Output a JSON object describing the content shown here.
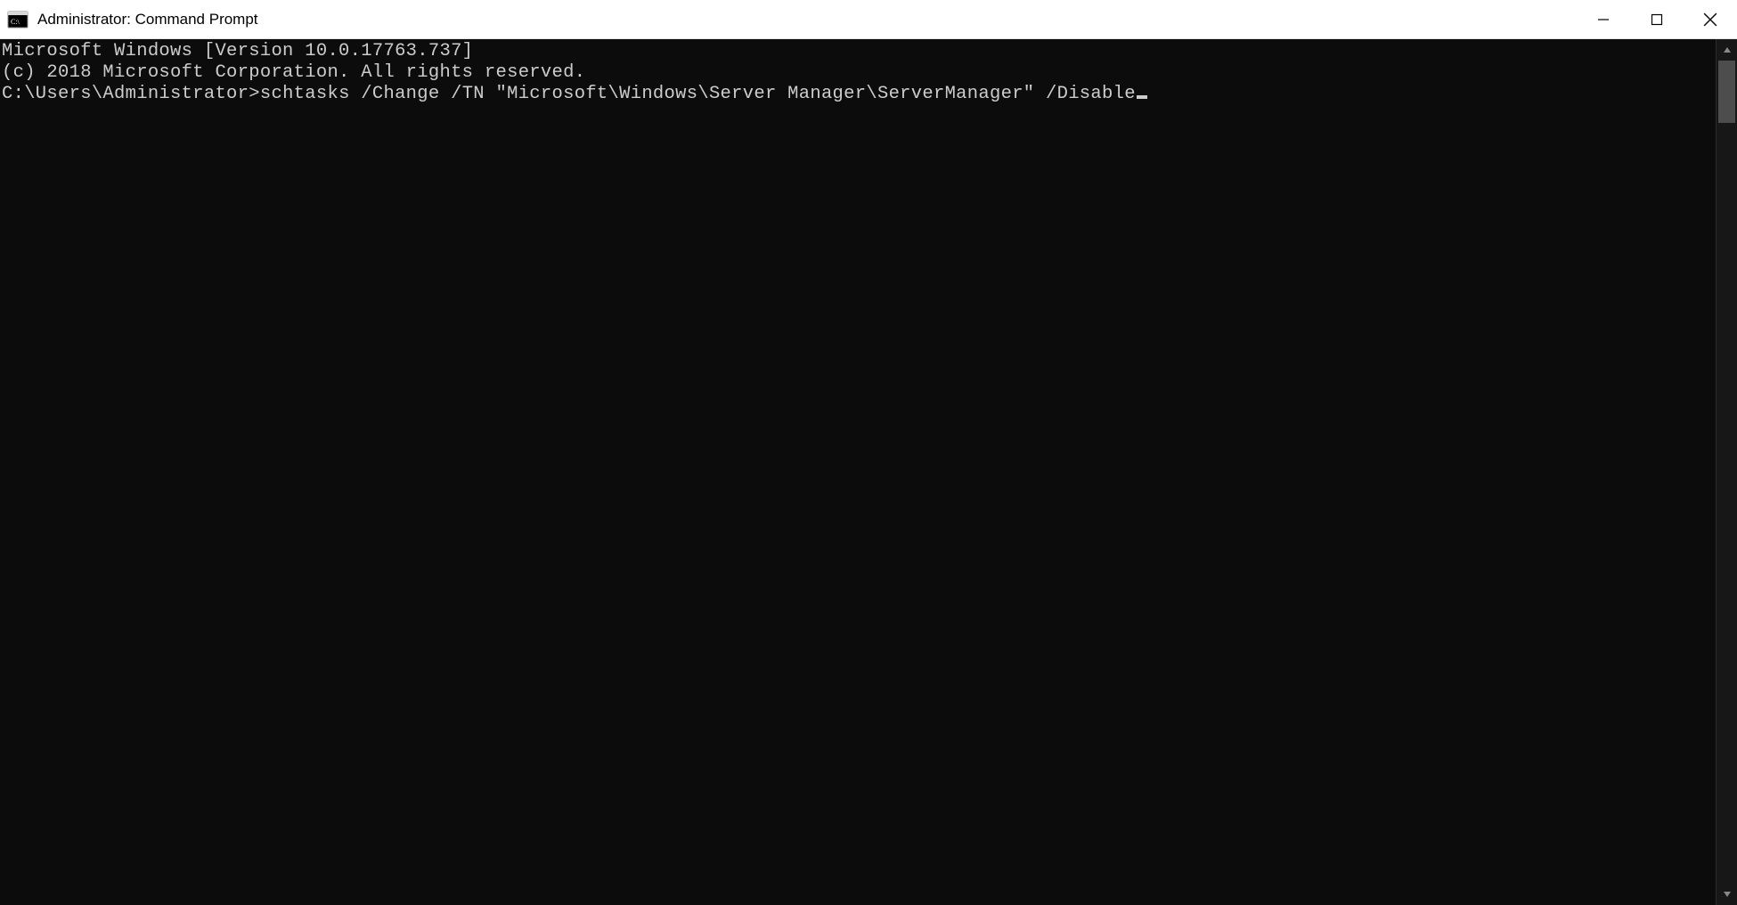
{
  "window": {
    "title": "Administrator: Command Prompt"
  },
  "console": {
    "lines": [
      "Microsoft Windows [Version 10.0.17763.737]",
      "(c) 2018 Microsoft Corporation. All rights reserved.",
      ""
    ],
    "prompt": "C:\\Users\\Administrator>",
    "command": "schtasks /Change /TN \"Microsoft\\Windows\\Server Manager\\ServerManager\" /Disable"
  }
}
